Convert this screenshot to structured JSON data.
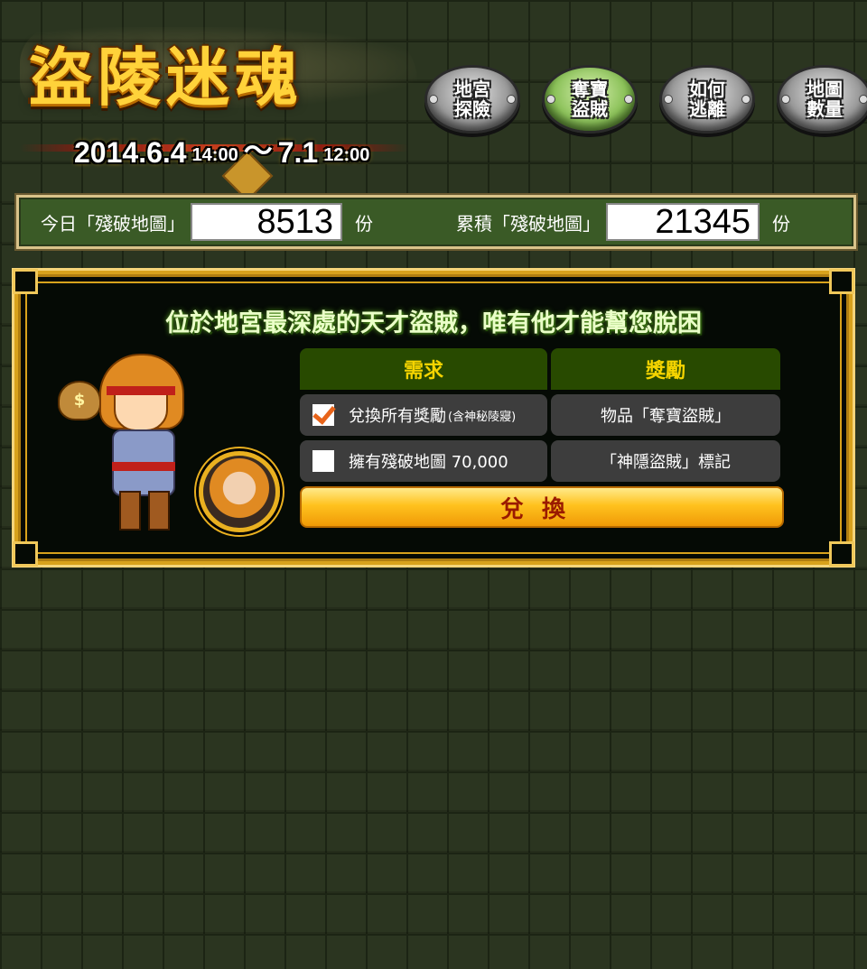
{
  "header": {
    "title": "盜陵迷魂",
    "date_start": "2014.6.4",
    "time_start": "14:00",
    "date_separator": "～",
    "date_end": "7.1",
    "time_end": "12:00"
  },
  "nav": [
    {
      "label": "地宮探險",
      "active": false
    },
    {
      "label": "奪寶盜賊",
      "active": true
    },
    {
      "label": "如何逃離",
      "active": false
    },
    {
      "label": "地圖數量",
      "active": false
    }
  ],
  "counters": {
    "today_label": "今日「殘破地圖」",
    "today_value": "8513",
    "today_unit": "份",
    "total_label": "累積「殘破地圖」",
    "total_value": "21345",
    "total_unit": "份"
  },
  "panel": {
    "title": "位於地宮最深處的天才盜賊，唯有他才能幫您脫困",
    "bag_symbol": "$",
    "table": {
      "col_requirement": "需求",
      "col_reward": "獎勵",
      "rows": [
        {
          "requirement": "兌換所有獎勵",
          "requirement_note": "(含神秘陵寢)",
          "reward": "物品「奪寶盜賊」",
          "checked": true
        },
        {
          "requirement": "擁有殘破地圖 70,000",
          "requirement_note": "",
          "reward": "「神隱盜賊」標記",
          "checked": false
        }
      ]
    },
    "exchange_button": "兌換"
  }
}
